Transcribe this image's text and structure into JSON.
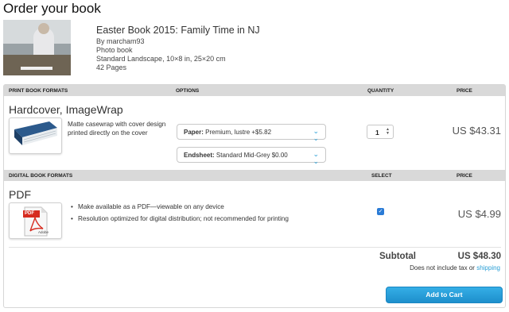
{
  "page": {
    "title": "Order your book"
  },
  "book": {
    "title": "Easter Book 2015: Family Time in NJ",
    "author": "By marcham93",
    "type": "Photo book",
    "format": "Standard Landscape, 10×8 in, 25×20 cm",
    "pages": "42 Pages"
  },
  "print_section": {
    "header": {
      "formats": "PRINT BOOK FORMATS",
      "options": "OPTIONS",
      "quantity": "QUANTITY",
      "price": "PRICE"
    },
    "product_title": "Hardcover, ImageWrap",
    "description": "Matte casewrap with cover design printed directly on the cover",
    "paper": {
      "label": "Paper:",
      "value": "Premium, lustre +$5.82"
    },
    "endsheet": {
      "label": "Endsheet:",
      "value": "Standard Mid-Grey $0.00"
    },
    "quantity": "1",
    "price": "US $43.31"
  },
  "digital_section": {
    "header": {
      "formats": "DIGITAL BOOK FORMATS",
      "select": "SELECT",
      "price": "PRICE"
    },
    "product_title": "PDF",
    "icon_label": "PDF",
    "icon_brand": "Adobe",
    "bullets": [
      "Make available as a PDF—viewable on any device",
      "Resolution optimized for digital distribution; not recommended for printing"
    ],
    "selected": true,
    "price": "US $4.99"
  },
  "summary": {
    "subtotal_label": "Subtotal",
    "subtotal_value": "US $48.30",
    "tax_note": "Does not include tax or",
    "shipping_link": "shipping"
  },
  "actions": {
    "add_to_cart": "Add to Cart"
  },
  "colors": {
    "accent": "#2a9fd6",
    "header_bg": "#d9d9d9",
    "button": "#1d8fcc",
    "pdf_red": "#d62b1f"
  }
}
